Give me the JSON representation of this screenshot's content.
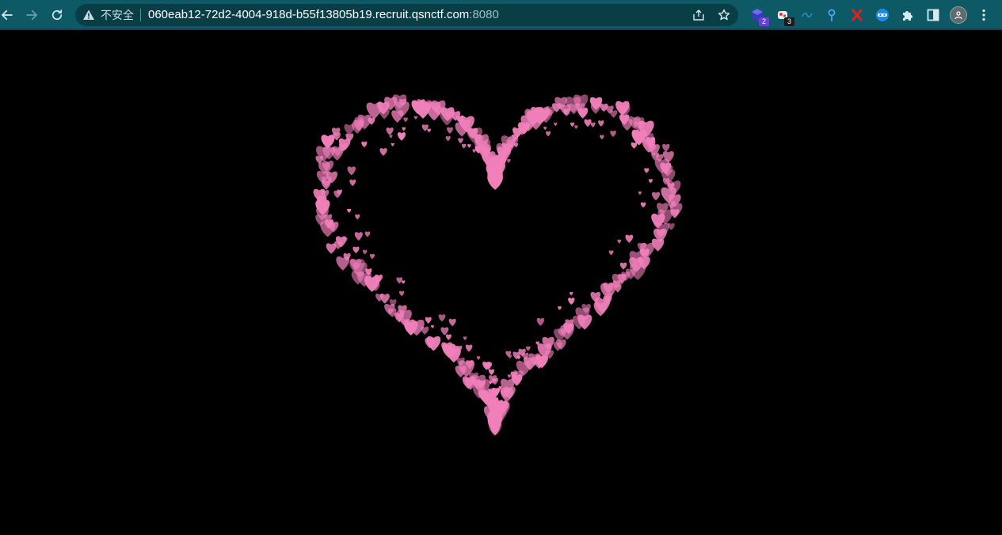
{
  "browser": {
    "security_label": "不安全",
    "url_host": "060eab12-72d2-4004-918d-b55f13805b19.recruit.qsnctf.com",
    "url_port": ":8080",
    "extensions": [
      {
        "name": "extension-1",
        "badge": "2"
      },
      {
        "name": "extension-2",
        "badge": "3"
      }
    ]
  },
  "colors": {
    "toolbar": "#0d5a66",
    "omnibox": "#0a3e47",
    "page_background": "#000000",
    "heart_pink": "#f07fba"
  },
  "icons": [
    "back-arrow-icon",
    "forward-arrow-icon",
    "reload-icon",
    "warning-icon",
    "share-icon",
    "star-icon",
    "puzzle-icon",
    "sidepanel-icon",
    "more-menu-icon"
  ],
  "scene": {
    "description_shape": "heart outline composed of many small pink hearts on black"
  }
}
